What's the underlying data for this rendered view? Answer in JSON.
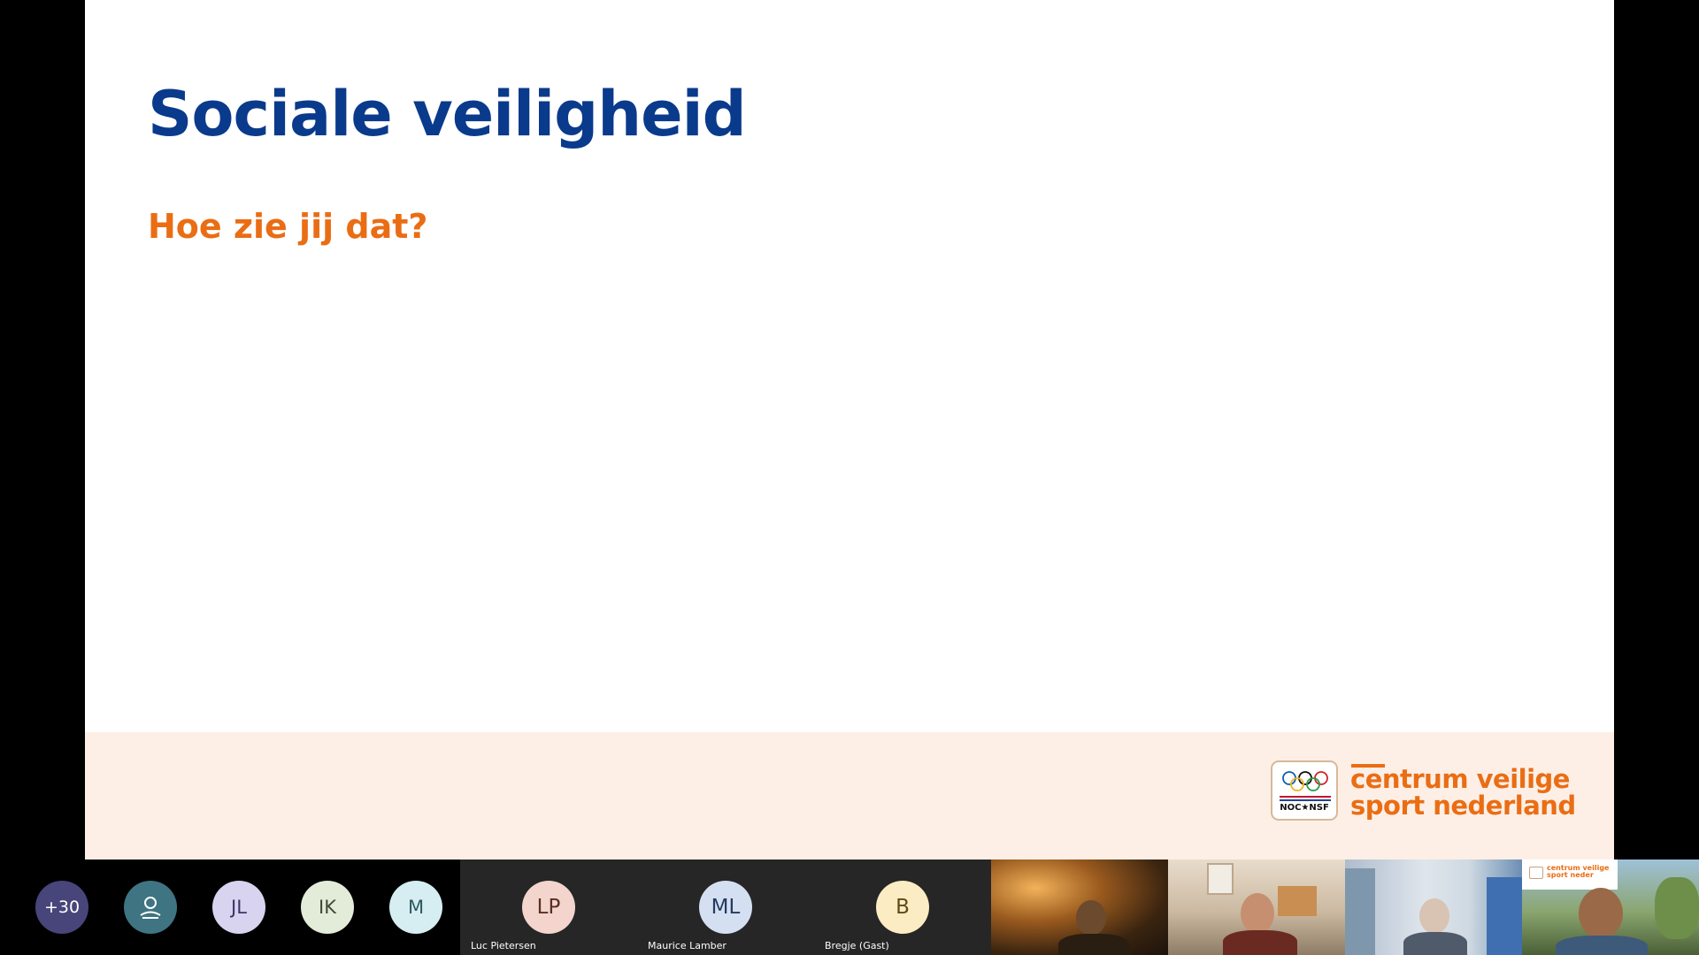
{
  "slide": {
    "title": "Sociale veiligheid",
    "subtitle": "Hoe zie jij dat?",
    "logo_text_line1": "centrum veilige",
    "logo_text_line2": "sport nederland",
    "badge_text": "NOC★NSF"
  },
  "strip": {
    "overflow_count": "+30",
    "avatars": [
      {
        "initials": "JL"
      },
      {
        "initials": "IK"
      },
      {
        "initials": "M"
      }
    ],
    "tiles": [
      {
        "initials": "LP",
        "name": "Luc Pietersen"
      },
      {
        "initials": "ML",
        "name": "Maurice Lamber"
      },
      {
        "initials": "B",
        "name": "Bregje (Gast)"
      }
    ],
    "mini_slide_logo_line1": "centrum veilige",
    "mini_slide_logo_line2": "sport neder"
  },
  "colors": {
    "title": "#0a3a8c",
    "accent_orange": "#ea6d14",
    "footer_bg": "#fdefe6"
  }
}
